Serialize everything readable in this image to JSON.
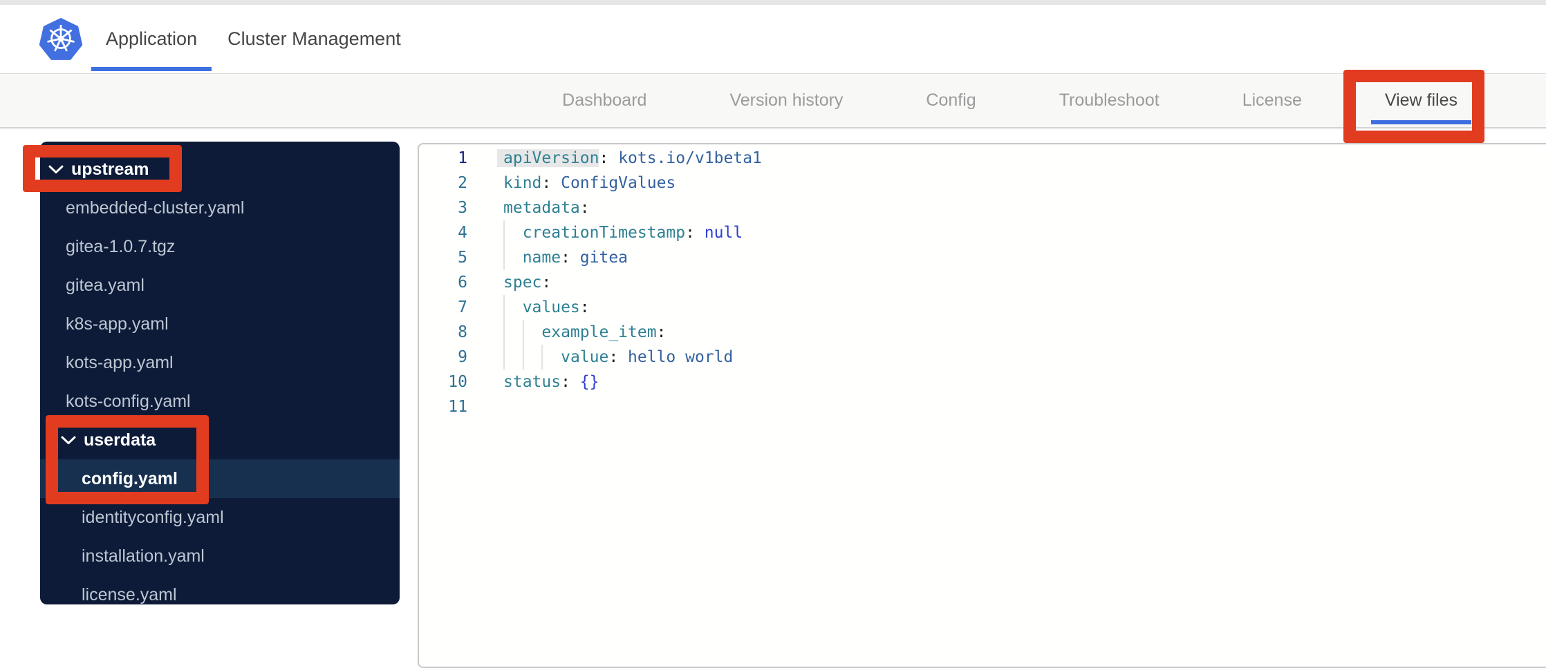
{
  "colors": {
    "accent_blue": "#3e6fe0",
    "annotation_red": "#e23c20",
    "sidebar_bg": "#0d1b38",
    "sidebar_selected_bg": "#17304f",
    "sidebar_file_text": "#bdc6d2",
    "code_key": "#2e8092",
    "code_string": "#33619f",
    "code_keyword": "#2e3fd4",
    "code_line_number": "#2d7191",
    "logo_blue": "#4270e0"
  },
  "icons": {
    "logo": "kubernetes-logo",
    "folder_chevron": "chevron-down"
  },
  "topnav": {
    "tabs": [
      {
        "label": "Application",
        "active": true
      },
      {
        "label": "Cluster Management",
        "active": false
      }
    ]
  },
  "subnav": {
    "tabs": [
      {
        "label": "Dashboard",
        "active": false
      },
      {
        "label": "Version history",
        "active": false
      },
      {
        "label": "Config",
        "active": false
      },
      {
        "label": "Troubleshoot",
        "active": false
      },
      {
        "label": "License",
        "active": false
      },
      {
        "label": "View files",
        "active": true
      }
    ]
  },
  "file_tree": {
    "items": [
      {
        "label": "upstream",
        "type": "folder",
        "level": 1,
        "expanded": true,
        "selected": false
      },
      {
        "label": "embedded-cluster.yaml",
        "type": "file",
        "level": 1,
        "selected": false
      },
      {
        "label": "gitea-1.0.7.tgz",
        "type": "file",
        "level": 1,
        "selected": false
      },
      {
        "label": "gitea.yaml",
        "type": "file",
        "level": 1,
        "selected": false
      },
      {
        "label": "k8s-app.yaml",
        "type": "file",
        "level": 1,
        "selected": false
      },
      {
        "label": "kots-app.yaml",
        "type": "file",
        "level": 1,
        "selected": false
      },
      {
        "label": "kots-config.yaml",
        "type": "file",
        "level": 1,
        "selected": false
      },
      {
        "label": "userdata",
        "type": "folder",
        "level": 2,
        "expanded": true,
        "selected": false
      },
      {
        "label": "config.yaml",
        "type": "file",
        "level": 2,
        "selected": true
      },
      {
        "label": "identityconfig.yaml",
        "type": "file",
        "level": 2,
        "selected": false
      },
      {
        "label": "installation.yaml",
        "type": "file",
        "level": 2,
        "selected": false
      },
      {
        "label": "license.yaml",
        "type": "file",
        "level": 2,
        "selected": false
      }
    ]
  },
  "editor": {
    "language": "yaml",
    "lines": [
      {
        "active": true,
        "indent": 0,
        "tokens": [
          {
            "t": "apiVersion",
            "c": "key",
            "hl": true
          },
          {
            "t": ": ",
            "c": "punc"
          },
          {
            "t": "kots.io/v1beta1",
            "c": "str"
          }
        ]
      },
      {
        "indent": 0,
        "tokens": [
          {
            "t": "kind",
            "c": "key"
          },
          {
            "t": ": ",
            "c": "punc"
          },
          {
            "t": "ConfigValues",
            "c": "str"
          }
        ]
      },
      {
        "indent": 0,
        "tokens": [
          {
            "t": "metadata",
            "c": "key"
          },
          {
            "t": ":",
            "c": "punc"
          }
        ]
      },
      {
        "indent": 1,
        "tokens": [
          {
            "t": "creationTimestamp",
            "c": "key"
          },
          {
            "t": ": ",
            "c": "punc"
          },
          {
            "t": "null",
            "c": "kw"
          }
        ]
      },
      {
        "indent": 1,
        "tokens": [
          {
            "t": "name",
            "c": "key"
          },
          {
            "t": ": ",
            "c": "punc"
          },
          {
            "t": "gitea",
            "c": "str"
          }
        ]
      },
      {
        "indent": 0,
        "tokens": [
          {
            "t": "spec",
            "c": "key"
          },
          {
            "t": ":",
            "c": "punc"
          }
        ]
      },
      {
        "indent": 1,
        "tokens": [
          {
            "t": "values",
            "c": "key"
          },
          {
            "t": ":",
            "c": "punc"
          }
        ]
      },
      {
        "indent": 2,
        "tokens": [
          {
            "t": "example_item",
            "c": "key"
          },
          {
            "t": ":",
            "c": "punc"
          }
        ]
      },
      {
        "indent": 3,
        "tokens": [
          {
            "t": "value",
            "c": "key"
          },
          {
            "t": ": ",
            "c": "punc"
          },
          {
            "t": "hello world",
            "c": "str"
          }
        ]
      },
      {
        "indent": 0,
        "tokens": [
          {
            "t": "status",
            "c": "key"
          },
          {
            "t": ": ",
            "c": "punc"
          },
          {
            "t": "{}",
            "c": "kw"
          }
        ]
      },
      {
        "indent": 0,
        "tokens": []
      }
    ]
  },
  "annotations": [
    {
      "target": "view-files-tab"
    },
    {
      "target": "upstream-folder"
    },
    {
      "target": "userdata-config-yaml"
    }
  ]
}
